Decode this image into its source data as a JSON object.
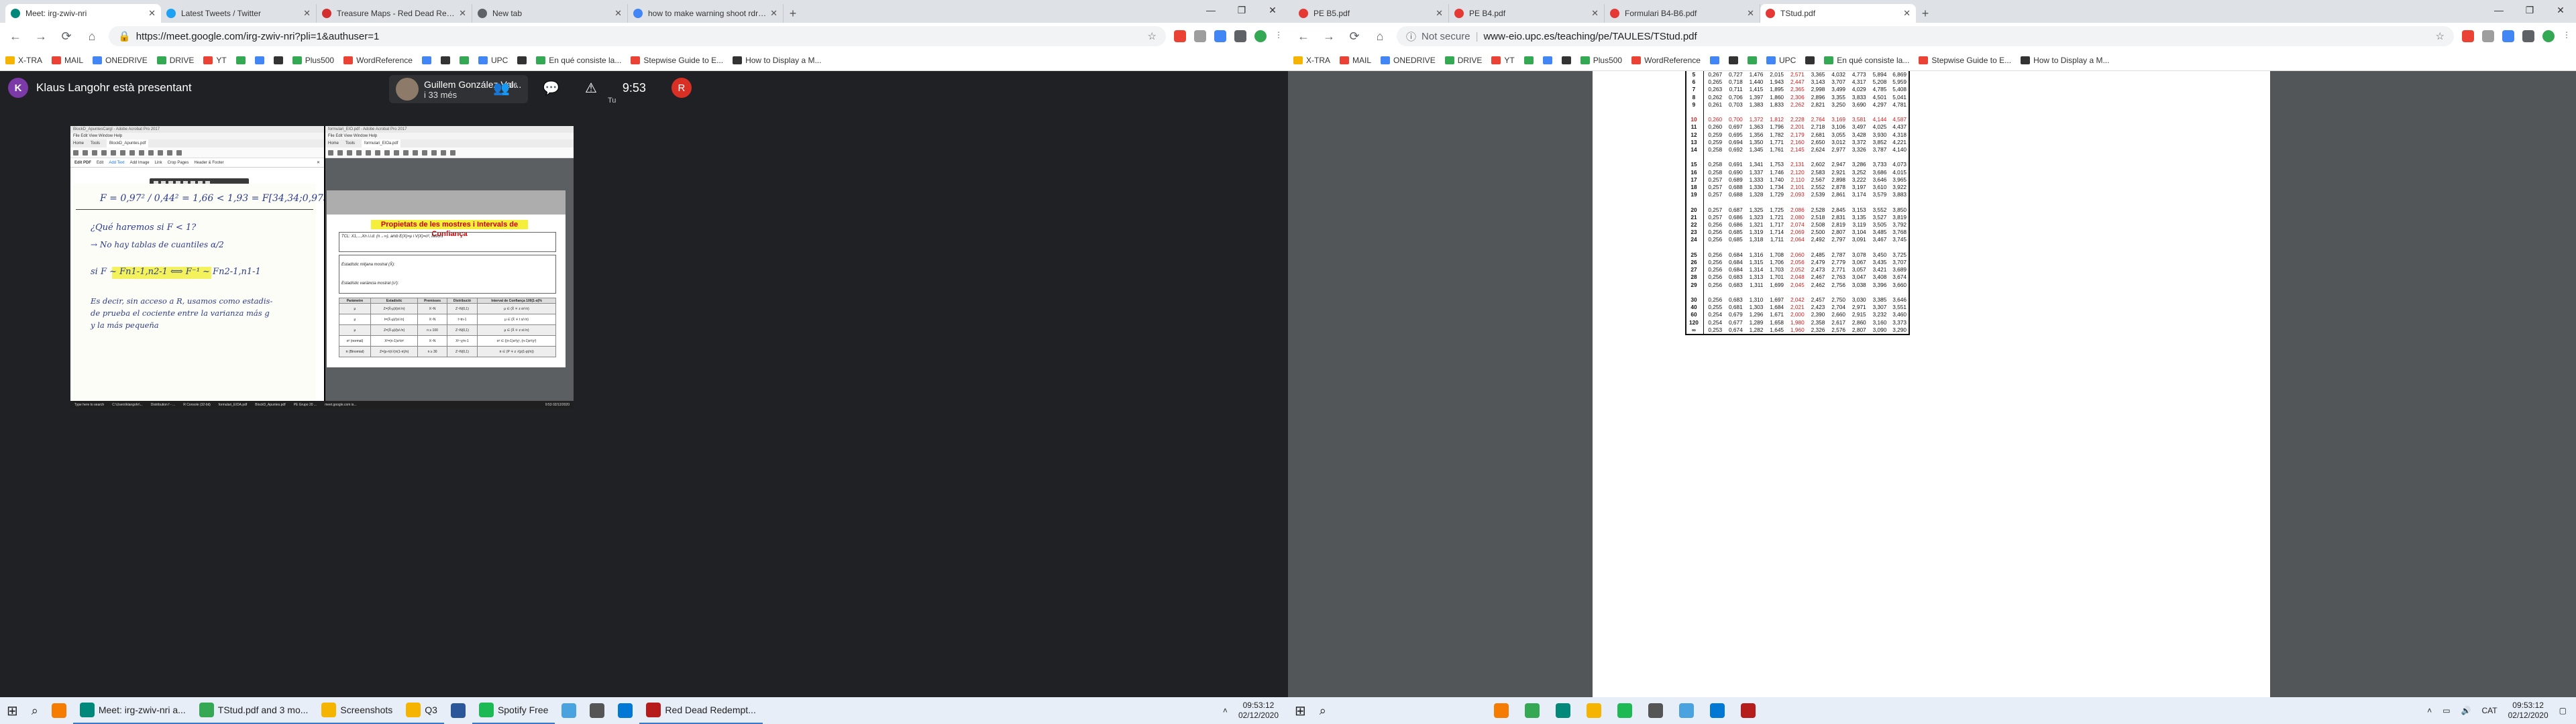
{
  "left": {
    "tabs": [
      {
        "label": "Meet: irg-zwiv-nri",
        "color": "#00897b",
        "active": true
      },
      {
        "label": "Latest Tweets / Twitter",
        "color": "#1da1f2"
      },
      {
        "label": "Treasure Maps - Red Dead Redem...",
        "color": "#d32f2f"
      },
      {
        "label": "New tab",
        "color": "#5f6368"
      },
      {
        "label": "how to make warning shoot rdr2 -",
        "color": "#4285f4"
      }
    ],
    "url": "https://meet.google.com/irg-zwiv-nri?pli=1&authuser=1",
    "bookmarks": [
      "X-TRA",
      "MAIL",
      "ONEDRIVE",
      "DRIVE",
      "YT",
      "",
      "",
      "",
      "Plus500",
      "WordReference",
      "",
      "",
      "",
      "UPC",
      "",
      "En qué consiste la...",
      "Stepwise Guide to E...",
      "How to Display a M..."
    ],
    "meet": {
      "presenter_initial": "K",
      "presenter_text": "Klaus Langohr està presentant",
      "guest_name": "Guillem González Val...",
      "guest_sub": "i 33 més",
      "participants_count": "36",
      "time": "9:53",
      "self_initial": "R",
      "self_label": "Tu"
    },
    "screen_share": {
      "left_window_title": "BlockD_ApuntesCargl - Adobe Acrobat Pro 2017",
      "left_menu": "File  Edit  View  Window  Help",
      "left_tabs": [
        "Home",
        "Tools",
        "BlockD_Apuntes.pdf"
      ],
      "edit_tools": [
        "Edit PDF",
        "Edit",
        "Add Text",
        "Add Image",
        "Link",
        "Crop Pages",
        "Header & Footer"
      ],
      "math_line": "F = 0,97² / 0,44² = 1,66 < 1,93 = F[34,34;0,975]",
      "notes": [
        "¿Qué haremos si F < 1?",
        "→ No hay tablas de cuantiles α/2",
        "si  F ~ Fn1-1,n2-1  ⟺  F⁻¹ ~ Fn2-1,n1-1",
        "Es decir, sin acceso a R, usamos como estadis-",
        "de prueba el cociente entre la varianza más g",
        "y la más pequeña"
      ],
      "right_window_title": "formulari_EIO.pdf - Adobe Acrobat Pro 2017",
      "right_tabs": [
        "Home",
        "Tools",
        "formulari_EIOa.pdf"
      ],
      "doc_title": "Propietats de les mostres i Intervals de Confiança",
      "doc_lines": [
        "TCL: X1,...,Xn i.i.d. (n→∞), amb E(X)=μ i V(X)=σ², llavors",
        "Estadístic mitjana mostral (X̄):",
        "Estadístic variància mostral (s²):"
      ],
      "table_headers": [
        "Paràmetre",
        "Estadístic",
        "Premisses",
        "Distribució",
        "Interval de Confiança 100(1-α)%"
      ],
      "table_rows": [
        [
          "μ",
          "Z=(X̄-μ)/(σ/√n)",
          "X~N",
          "Z~N(0,1)",
          "μ ∈ (X̄ ∓ z σ/√n)"
        ],
        [
          "μ",
          "t=(X̄-μ)/(s/√n)",
          "X~N",
          "t~tn-1",
          "μ ∈ (X̄ ∓ t s/√n)"
        ],
        [
          "μ",
          "Z=(X̄-μ)/(s/√n)",
          "n ≥ 100",
          "Z~N(0,1)",
          "μ ∈ (X̄ ∓ z s/√n)"
        ],
        [
          "σ² (normal)",
          "X²=(n-1)s²/σ²",
          "X~N",
          "X²~χ²n-1",
          "σ² ∈ ((n-1)s²/χ², (n-1)s²/χ²)"
        ],
        [
          "π (Binomial)",
          "Z=(p-π)/√(π(1-π)/n)",
          "n ≥ 30",
          "Z~N(0,1)",
          "π ∈ (P ∓ z √(p(1-p)/n))"
        ]
      ],
      "inner_taskbar": [
        "Type here to search",
        "C:\\Users\\klangohr\\...",
        "Distribution f - ...",
        "R Console (32-bit)",
        "formulari_EIOA.pdf",
        "BlockD_Apuntes.pdf",
        "PE Grupo 20 ...",
        "meet.google.com is..."
      ],
      "inner_time": "9:53",
      "inner_date": "02/12/2020"
    }
  },
  "right": {
    "tabs": [
      {
        "label": "PE B5.pdf",
        "color": "#e53935"
      },
      {
        "label": "PE B4.pdf",
        "color": "#e53935"
      },
      {
        "label": "Formulari B4-B6.pdf",
        "color": "#e53935"
      },
      {
        "label": "TStud.pdf",
        "color": "#e53935",
        "active": true
      }
    ],
    "security": "Not secure",
    "url": "www-eio.upc.es/teaching/pe/TAULES/TStud.pdf",
    "bookmarks": [
      "X-TRA",
      "MAIL",
      "ONEDRIVE",
      "DRIVE",
      "YT",
      "",
      "",
      "",
      "Plus500",
      "WordReference",
      "",
      "",
      "",
      "UPC",
      "",
      "En qué consiste la...",
      "Stepwise Guide to E...",
      "How to Display a M..."
    ],
    "tstud_rows": [
      [
        "5",
        "0,267",
        "0,727",
        "1,476",
        "2,015",
        "2,571",
        "3,365",
        "4,032",
        "4,773",
        "5,894",
        "6,869"
      ],
      [
        "6",
        "0,265",
        "0,718",
        "1,440",
        "1,943",
        "2,447",
        "3,143",
        "3,707",
        "4,317",
        "5,208",
        "5,959"
      ],
      [
        "7",
        "0,263",
        "0,711",
        "1,415",
        "1,895",
        "2,365",
        "2,998",
        "3,499",
        "4,029",
        "4,785",
        "5,408"
      ],
      [
        "8",
        "0,262",
        "0,706",
        "1,397",
        "1,860",
        "2,306",
        "2,896",
        "3,355",
        "3,833",
        "4,501",
        "5,041"
      ],
      [
        "9",
        "0,261",
        "0,703",
        "1,383",
        "1,833",
        "2,262",
        "2,821",
        "3,250",
        "3,690",
        "4,297",
        "4,781"
      ],
      [
        "",
        "",
        "",
        "",
        "",
        "",
        "",
        "",
        "",
        "",
        ""
      ],
      [
        "10",
        "0,260",
        "0,700",
        "1,372",
        "1,812",
        "2,228",
        "2,764",
        "3,169",
        "3,581",
        "4,144",
        "4,587"
      ],
      [
        "11",
        "0,260",
        "0,697",
        "1,363",
        "1,796",
        "2,201",
        "2,718",
        "3,106",
        "3,497",
        "4,025",
        "4,437"
      ],
      [
        "12",
        "0,259",
        "0,695",
        "1,356",
        "1,782",
        "2,179",
        "2,681",
        "3,055",
        "3,428",
        "3,930",
        "4,318"
      ],
      [
        "13",
        "0,259",
        "0,694",
        "1,350",
        "1,771",
        "2,160",
        "2,650",
        "3,012",
        "3,372",
        "3,852",
        "4,221"
      ],
      [
        "14",
        "0,258",
        "0,692",
        "1,345",
        "1,761",
        "2,145",
        "2,624",
        "2,977",
        "3,326",
        "3,787",
        "4,140"
      ],
      [
        "",
        "",
        "",
        "",
        "",
        "",
        "",
        "",
        "",
        "",
        ""
      ],
      [
        "15",
        "0,258",
        "0,691",
        "1,341",
        "1,753",
        "2,131",
        "2,602",
        "2,947",
        "3,286",
        "3,733",
        "4,073"
      ],
      [
        "16",
        "0,258",
        "0,690",
        "1,337",
        "1,746",
        "2,120",
        "2,583",
        "2,921",
        "3,252",
        "3,686",
        "4,015"
      ],
      [
        "17",
        "0,257",
        "0,689",
        "1,333",
        "1,740",
        "2,110",
        "2,567",
        "2,898",
        "3,222",
        "3,646",
        "3,965"
      ],
      [
        "18",
        "0,257",
        "0,688",
        "1,330",
        "1,734",
        "2,101",
        "2,552",
        "2,878",
        "3,197",
        "3,610",
        "3,922"
      ],
      [
        "19",
        "0,257",
        "0,688",
        "1,328",
        "1,729",
        "2,093",
        "2,539",
        "2,861",
        "3,174",
        "3,579",
        "3,883"
      ],
      [
        "",
        "",
        "",
        "",
        "",
        "",
        "",
        "",
        "",
        "",
        ""
      ],
      [
        "20",
        "0,257",
        "0,687",
        "1,325",
        "1,725",
        "2,086",
        "2,528",
        "2,845",
        "3,153",
        "3,552",
        "3,850"
      ],
      [
        "21",
        "0,257",
        "0,686",
        "1,323",
        "1,721",
        "2,080",
        "2,518",
        "2,831",
        "3,135",
        "3,527",
        "3,819"
      ],
      [
        "22",
        "0,256",
        "0,686",
        "1,321",
        "1,717",
        "2,074",
        "2,508",
        "2,819",
        "3,119",
        "3,505",
        "3,792"
      ],
      [
        "23",
        "0,256",
        "0,685",
        "1,319",
        "1,714",
        "2,069",
        "2,500",
        "2,807",
        "3,104",
        "3,485",
        "3,768"
      ],
      [
        "24",
        "0,256",
        "0,685",
        "1,318",
        "1,711",
        "2,064",
        "2,492",
        "2,797",
        "3,091",
        "3,467",
        "3,745"
      ],
      [
        "",
        "",
        "",
        "",
        "",
        "",
        "",
        "",
        "",
        "",
        ""
      ],
      [
        "25",
        "0,256",
        "0,684",
        "1,316",
        "1,708",
        "2,060",
        "2,485",
        "2,787",
        "3,078",
        "3,450",
        "3,725"
      ],
      [
        "26",
        "0,256",
        "0,684",
        "1,315",
        "1,706",
        "2,056",
        "2,479",
        "2,779",
        "3,067",
        "3,435",
        "3,707"
      ],
      [
        "27",
        "0,256",
        "0,684",
        "1,314",
        "1,703",
        "2,052",
        "2,473",
        "2,771",
        "3,057",
        "3,421",
        "3,689"
      ],
      [
        "28",
        "0,256",
        "0,683",
        "1,313",
        "1,701",
        "2,048",
        "2,467",
        "2,763",
        "3,047",
        "3,408",
        "3,674"
      ],
      [
        "29",
        "0,256",
        "0,683",
        "1,311",
        "1,699",
        "2,045",
        "2,462",
        "2,756",
        "3,038",
        "3,396",
        "3,660"
      ],
      [
        "",
        "",
        "",
        "",
        "",
        "",
        "",
        "",
        "",
        "",
        ""
      ],
      [
        "30",
        "0,256",
        "0,683",
        "1,310",
        "1,697",
        "2,042",
        "2,457",
        "2,750",
        "3,030",
        "3,385",
        "3,646"
      ],
      [
        "40",
        "0,255",
        "0,681",
        "1,303",
        "1,684",
        "2,021",
        "2,423",
        "2,704",
        "2,971",
        "3,307",
        "3,551"
      ],
      [
        "60",
        "0,254",
        "0,679",
        "1,296",
        "1,671",
        "2,000",
        "2,390",
        "2,660",
        "2,915",
        "3,232",
        "3,460"
      ],
      [
        "120",
        "0,254",
        "0,677",
        "1,289",
        "1,658",
        "1,980",
        "2,358",
        "2,617",
        "2,860",
        "3,160",
        "3,373"
      ],
      [
        "∞",
        "0,253",
        "0,674",
        "1,282",
        "1,645",
        "1,960",
        "2,326",
        "2,576",
        "2,807",
        "3,090",
        "3,290"
      ]
    ]
  },
  "taskbar_left": {
    "items": [
      {
        "label": "",
        "color": "#f57c00"
      },
      {
        "label": "Meet: irg-zwiv-nri a...",
        "color": "#00897b"
      },
      {
        "label": "TStud.pdf and 3 mo...",
        "color": "#34a853"
      },
      {
        "label": "Screenshots",
        "color": "#f4b400"
      },
      {
        "label": "Q3",
        "color": "#f4b400"
      },
      {
        "label": "",
        "color": "#2b579a"
      },
      {
        "label": "Spotify Free",
        "color": "#1db954"
      },
      {
        "label": "",
        "color": "#4aa3df"
      },
      {
        "label": "",
        "color": "#555555"
      },
      {
        "label": "",
        "color": "#0078d4"
      },
      {
        "label": "Red Dead Redempt...",
        "color": "#b71c1c"
      }
    ],
    "time": "09:53:12",
    "date": "02/12/2020"
  },
  "taskbar_right": {
    "lang": "CAT",
    "time": "09:53:12",
    "date": "02/12/2020"
  }
}
